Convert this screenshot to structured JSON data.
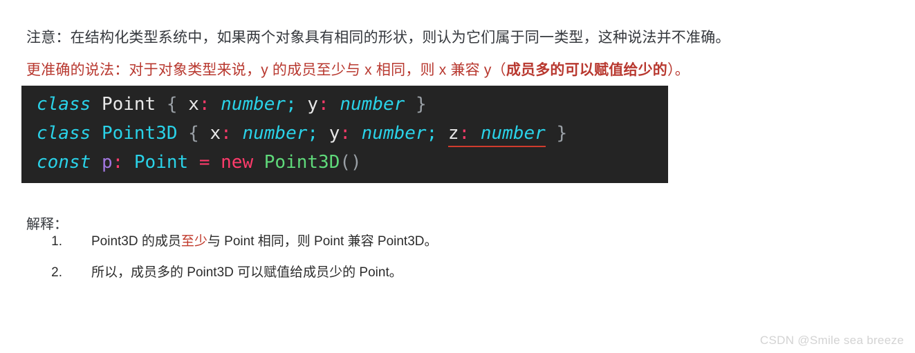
{
  "document": {
    "note_paragraph": {
      "text": "注意：在结构化类型系统中，如果两个对象具有相同的形状，则认为它们属于同一类型，这种说法并不准确。",
      "color": "#35383d"
    },
    "accurate_paragraph": {
      "lead": "更准确的说法：对于对象类型来说，y 的成员至少与 x 相同，则 x 兼容 y（",
      "emphasis": "成员多的可以赋值给少的",
      "tail": "）。",
      "color": "#b8382f"
    },
    "code_block": {
      "background": "#242424",
      "lines": [
        {
          "tokens": [
            {
              "text": "class",
              "kind": "keyword"
            },
            {
              "text": " ",
              "kind": "plain"
            },
            {
              "text": "Point",
              "kind": "plain"
            },
            {
              "text": " ",
              "kind": "plain"
            },
            {
              "text": "{",
              "kind": "punct"
            },
            {
              "text": " ",
              "kind": "plain"
            },
            {
              "text": "x",
              "kind": "plain"
            },
            {
              "text": ":",
              "kind": "colon"
            },
            {
              "text": " ",
              "kind": "plain"
            },
            {
              "text": "number",
              "kind": "type-italic"
            },
            {
              "text": ";",
              "kind": "semi"
            },
            {
              "text": " ",
              "kind": "plain"
            },
            {
              "text": "y",
              "kind": "plain"
            },
            {
              "text": ":",
              "kind": "colon"
            },
            {
              "text": " ",
              "kind": "plain"
            },
            {
              "text": "number",
              "kind": "type-italic"
            },
            {
              "text": " ",
              "kind": "plain"
            },
            {
              "text": "}",
              "kind": "punct"
            }
          ]
        },
        {
          "tokens": [
            {
              "text": "class",
              "kind": "keyword"
            },
            {
              "text": " ",
              "kind": "plain"
            },
            {
              "text": "Point3D",
              "kind": "type"
            },
            {
              "text": " ",
              "kind": "plain"
            },
            {
              "text": "{",
              "kind": "punct"
            },
            {
              "text": " ",
              "kind": "plain"
            },
            {
              "text": "x",
              "kind": "plain"
            },
            {
              "text": ":",
              "kind": "colon"
            },
            {
              "text": " ",
              "kind": "plain"
            },
            {
              "text": "number",
              "kind": "type-italic"
            },
            {
              "text": ";",
              "kind": "semi"
            },
            {
              "text": " ",
              "kind": "plain"
            },
            {
              "text": "y",
              "kind": "plain"
            },
            {
              "text": ":",
              "kind": "colon"
            },
            {
              "text": " ",
              "kind": "plain"
            },
            {
              "text": "number",
              "kind": "type-italic"
            },
            {
              "text": ";",
              "kind": "semi"
            },
            {
              "text": " ",
              "kind": "plain"
            },
            {
              "text": "z",
              "kind": "plain",
              "error": true
            },
            {
              "text": ":",
              "kind": "colon",
              "error": true
            },
            {
              "text": " ",
              "kind": "plain",
              "error": true
            },
            {
              "text": "number",
              "kind": "type-italic",
              "error": true
            },
            {
              "text": " ",
              "kind": "plain"
            },
            {
              "text": "}",
              "kind": "punct"
            }
          ]
        },
        {
          "tokens": [
            {
              "text": "const",
              "kind": "keyword"
            },
            {
              "text": " ",
              "kind": "plain"
            },
            {
              "text": "p",
              "kind": "var"
            },
            {
              "text": ":",
              "kind": "colon"
            },
            {
              "text": " ",
              "kind": "plain"
            },
            {
              "text": "Point",
              "kind": "type"
            },
            {
              "text": " ",
              "kind": "plain"
            },
            {
              "text": "=",
              "kind": "op"
            },
            {
              "text": " ",
              "kind": "plain"
            },
            {
              "text": "new",
              "kind": "op"
            },
            {
              "text": " ",
              "kind": "plain"
            },
            {
              "text": "Point3D",
              "kind": "ctor"
            },
            {
              "text": "()",
              "kind": "punct"
            }
          ]
        }
      ]
    },
    "explanation": {
      "title": "解释：",
      "items": [
        {
          "marker": "1.",
          "lead": "Point3D 的成员",
          "highlight": "至少",
          "tail": "与 Point 相同，则 Point 兼容 Point3D。"
        },
        {
          "marker": "2.",
          "lead": "所以，成员多的 Point3D 可以赋值给成员少的 Point。",
          "highlight": "",
          "tail": ""
        }
      ]
    },
    "watermark": "CSDN @Smile sea breeze"
  }
}
